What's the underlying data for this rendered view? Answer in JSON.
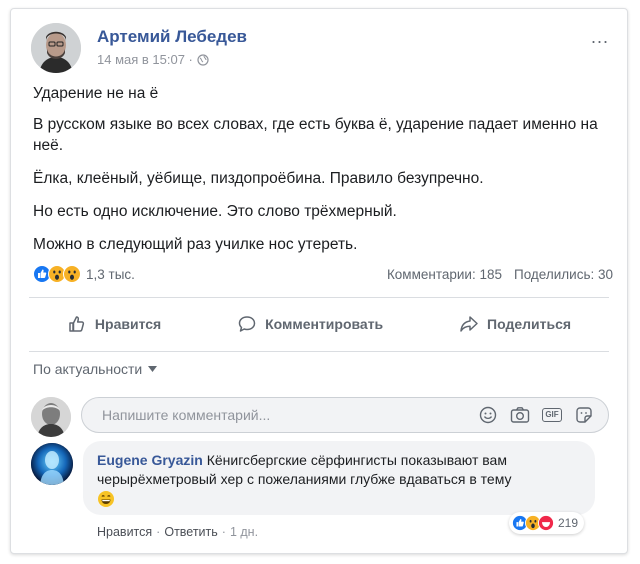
{
  "post": {
    "author": "Артемий Лебедев",
    "timestamp": "14 мая в 15:07 ·",
    "privacy_icon": "globe-icon",
    "more_menu": "...",
    "paragraphs": [
      "Ударение не на ё",
      "В русском языке во всех словах, где есть буква ё, ударение падает именно на неё.",
      "Ёлка, клеёный, уёбище, пиздопроёбина. Правило безупречно.",
      "Но есть одно исключение. Это слово трёхмерный.",
      "Можно в следующий раз училке нос утереть."
    ]
  },
  "reactions": {
    "icons": [
      "like-icon",
      "wow-icon",
      "wow-icon"
    ],
    "count": "1,3 тыс.",
    "comments": "Комментарии: 185",
    "shares": "Поделились: 30"
  },
  "actions": {
    "like": "Нравится",
    "comment": "Комментировать",
    "share": "Поделиться"
  },
  "sort": {
    "label": "По актуальности"
  },
  "composer": {
    "placeholder": "Напишите комментарий...",
    "gif_label": "GIF"
  },
  "comment": {
    "author": "Eugene Gryazin",
    "text": "Кёнигсбергские сёрфингисты показывают вам черырёхметровый хер с пожеланиями глубже вдаваться в тему",
    "emoji": "grin-emoji",
    "reaction_count": "219",
    "like": "Нравится",
    "reply": "Ответить",
    "time": "1 дн."
  },
  "colors": {
    "link": "#385898",
    "secondary_text": "#606770",
    "meta_text": "#90949c",
    "like_blue": "#1877f2",
    "wow_yellow": "#f7b125",
    "haha_red": "#f0284a"
  }
}
